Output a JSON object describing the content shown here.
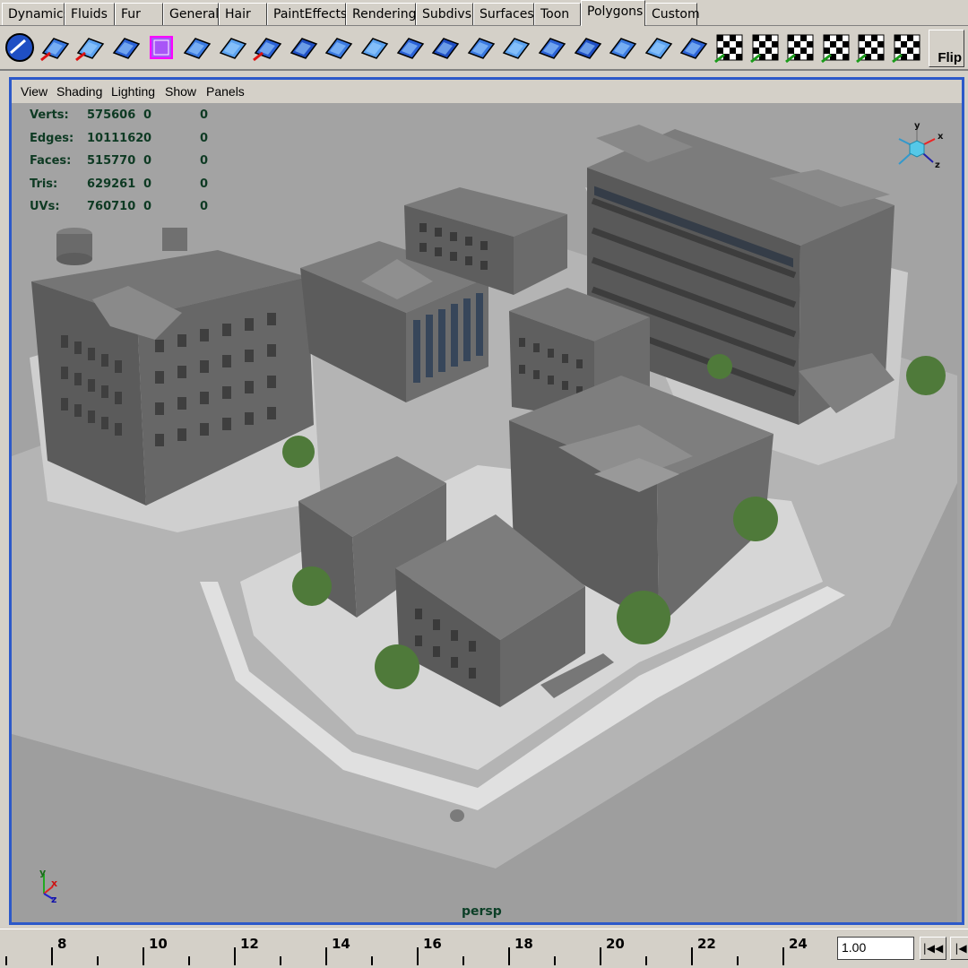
{
  "shelf": {
    "tabs": [
      "Dynamics",
      "Fluids",
      "Fur",
      "General",
      "Hair",
      "PaintEffects",
      "Rendering",
      "Subdivs",
      "Surfaces",
      "Toon",
      "Polygons",
      "Custom"
    ],
    "active_tab": "Polygons",
    "flip_label": "Flip",
    "icons": [
      "poly-sphere-icon",
      "poly-cube-icon",
      "poly-cylinder-icon",
      "poly-cone-icon",
      "poly-plane-icon",
      "combine-icon",
      "separate-icon",
      "extrude-face-icon",
      "bevel-icon",
      "split-polygon-icon",
      "duplicate-face-icon",
      "extract-icon",
      "merge-edge-icon",
      "poke-face-icon",
      "wedge-face-icon",
      "subdivide-icon",
      "smooth-icon",
      "fill-hole-icon",
      "append-polygon-icon",
      "move-pivot-icon",
      "planar-map-icon",
      "automatic-map-icon",
      "cylindrical-map-icon",
      "spherical-map-icon",
      "cut-uvs-icon",
      "sew-uvs-icon"
    ]
  },
  "panel_menu": [
    "View",
    "Shading",
    "Lighting",
    "Show",
    "Panels"
  ],
  "hud": {
    "rows": [
      {
        "label": "Verts:",
        "total": "575606",
        "sel": "0",
        "comp": "0"
      },
      {
        "label": "Edges:",
        "total": "1011162",
        "sel": "0",
        "comp": "0"
      },
      {
        "label": "Faces:",
        "total": "515770",
        "sel": "0",
        "comp": "0"
      },
      {
        "label": "Tris:",
        "total": "629261",
        "sel": "0",
        "comp": "0"
      },
      {
        "label": "UVs:",
        "total": "760710",
        "sel": "0",
        "comp": "0"
      }
    ]
  },
  "view_cube": {
    "x": "x",
    "y": "y",
    "z": "z"
  },
  "axis_gizmo": {
    "x": "x",
    "y": "y",
    "z": "z"
  },
  "camera_name": "persp",
  "timeline": {
    "ticks": [
      "8",
      "10",
      "12",
      "14",
      "16",
      "18",
      "20",
      "22",
      "24"
    ],
    "current_time": "1.00",
    "buttons": [
      "|◀◀",
      "|◀"
    ]
  },
  "colors": {
    "viewport_border": "#2c59c9",
    "hud_text": "#0e3a23",
    "background": "#a3a3a3",
    "ground": "#c8c8c8",
    "building": "#6a6a6a"
  }
}
